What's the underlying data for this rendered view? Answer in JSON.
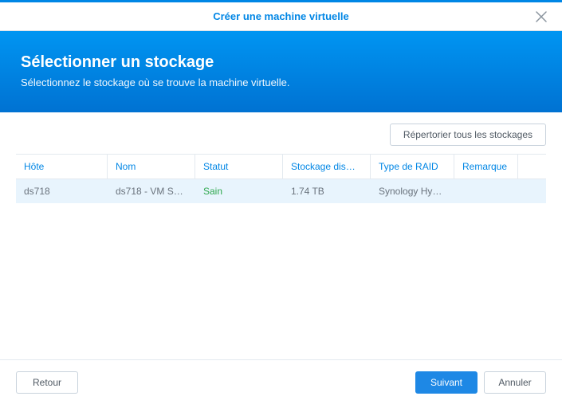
{
  "titlebar": {
    "title": "Créer une machine virtuelle"
  },
  "banner": {
    "heading": "Sélectionner un stockage",
    "subheading": "Sélectionnez le stockage où se trouve la machine virtuelle."
  },
  "toolbar": {
    "list_all_label": "Répertorier tous les stockages"
  },
  "table": {
    "columns": {
      "host": "Hôte",
      "name": "Nom",
      "status": "Statut",
      "storage": "Stockage dis…",
      "raid": "Type de RAID",
      "remark": "Remarque"
    },
    "rows": [
      {
        "host": "ds718",
        "name": "ds718 - VM S…",
        "status": "Sain",
        "storage": "1.74 TB",
        "raid": "Synology Hy…",
        "remark": ""
      }
    ]
  },
  "footer": {
    "back": "Retour",
    "next": "Suivant",
    "cancel": "Annuler"
  }
}
